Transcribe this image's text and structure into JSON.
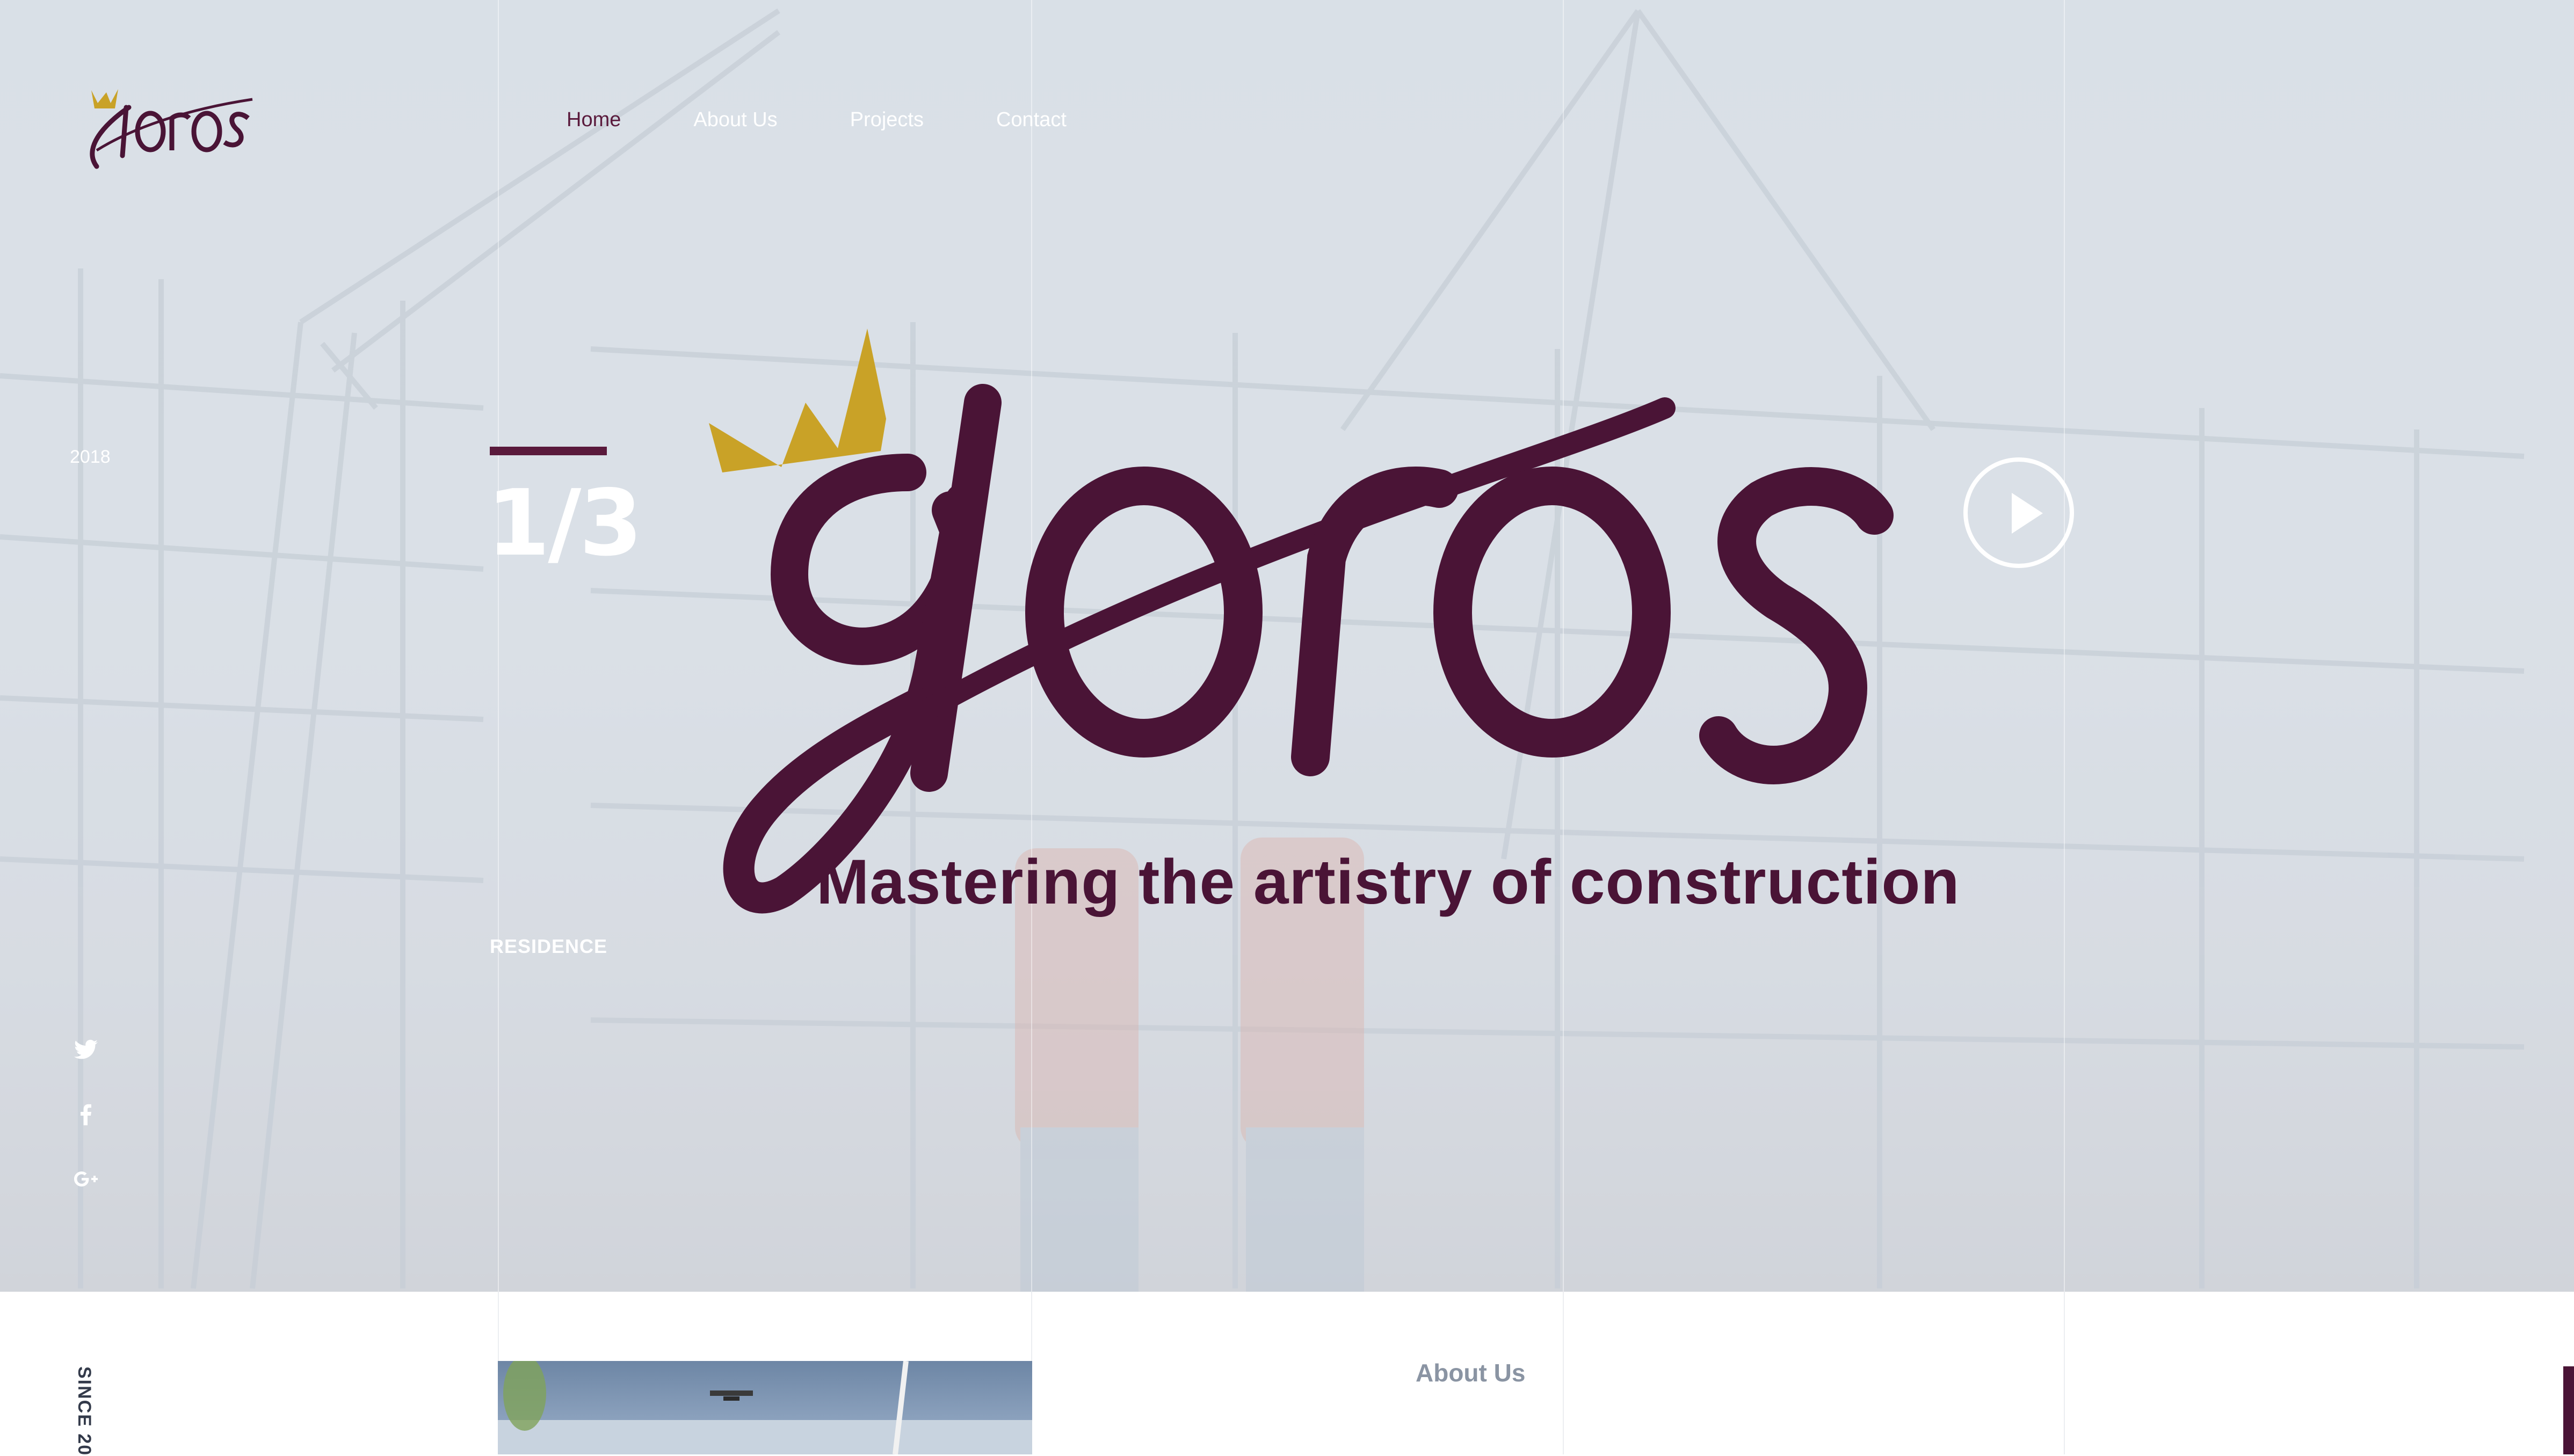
{
  "brand": {
    "name": "gloros",
    "tagline": "Mastering the artistry of construction"
  },
  "nav": {
    "items": [
      {
        "label": "Home",
        "active": true
      },
      {
        "label": "About Us",
        "active": false
      },
      {
        "label": "Projects",
        "active": false
      },
      {
        "label": "Contact",
        "active": false
      }
    ]
  },
  "hero": {
    "year": "2018",
    "slide_counter": "1/3",
    "slide_category": "RESIDENCE",
    "social": [
      "twitter-icon",
      "facebook-icon",
      "google-plus-icon"
    ]
  },
  "about": {
    "since": "SINCE 20",
    "heading": "About Us"
  },
  "colors": {
    "brand": "#4a1436",
    "crown": "#c9a227",
    "accent": "#5a1a3c"
  }
}
